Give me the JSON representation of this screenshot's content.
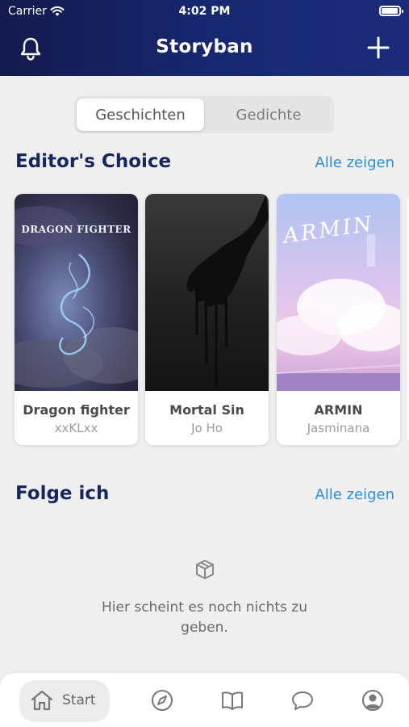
{
  "status_bar": {
    "carrier": "Carrier",
    "time": "4:02 PM",
    "battery_level": 0.95
  },
  "header": {
    "title": "Storyban",
    "left_icon": "bell-icon",
    "right_icon": "plus-icon"
  },
  "segments": [
    {
      "label": "Geschichten",
      "selected": true
    },
    {
      "label": "Gedichte",
      "selected": false
    }
  ],
  "editors_choice": {
    "title": "Editor's Choice",
    "see_all": "Alle zeigen",
    "books": [
      {
        "title": "Dragon fighter",
        "author": "xxKLxx",
        "cover_text": "DRAGON FIGHTER"
      },
      {
        "title": "Mortal Sin",
        "author": "Jo Ho"
      },
      {
        "title": "ARMIN",
        "author": "Jasminana",
        "cover_text": "ARMIN"
      }
    ]
  },
  "following": {
    "title": "Folge ich",
    "see_all": "Alle zeigen",
    "empty_icon": "box-icon",
    "empty_text": "Hier scheint es noch nichts zu geben."
  },
  "tabbar": {
    "tabs": [
      {
        "label": "Start",
        "icon": "home-icon",
        "selected": true
      },
      {
        "icon": "compass-icon"
      },
      {
        "icon": "book-icon"
      },
      {
        "icon": "chat-bubble-icon"
      },
      {
        "icon": "user-circle-icon"
      }
    ]
  },
  "colors": {
    "header_bg": "#172873",
    "accent": "#2a8fe0",
    "heading": "#17275e"
  }
}
